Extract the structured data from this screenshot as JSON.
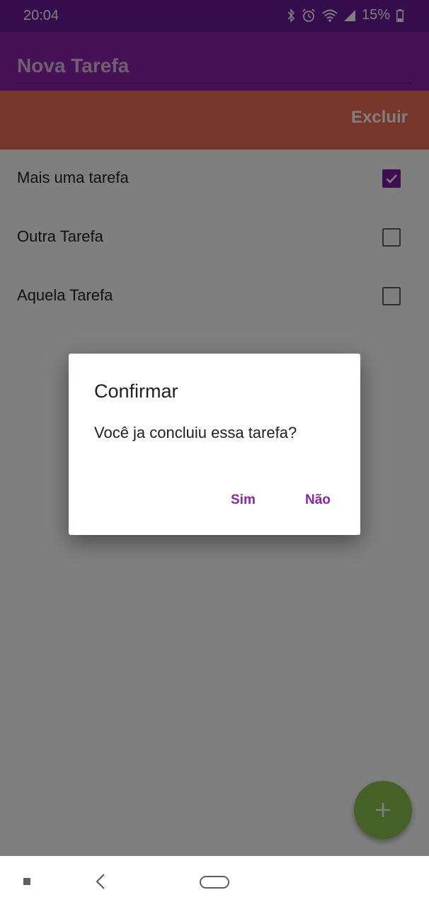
{
  "status_bar": {
    "time": "20:04",
    "battery": "15%",
    "icons": [
      "bluetooth-icon",
      "alarm-icon",
      "wifi-icon",
      "signal-icon",
      "battery-icon"
    ]
  },
  "app_bar": {
    "input_value": "Nova Tarefa",
    "color": "#8e24aa"
  },
  "swipe_action": {
    "label": "Excluir",
    "color": "#ef6c52"
  },
  "tasks": [
    {
      "label": "Mais uma tarefa",
      "checked": true
    },
    {
      "label": "Outra Tarefa",
      "checked": false
    },
    {
      "label": "Aquela Tarefa",
      "checked": false
    }
  ],
  "fab": {
    "icon": "add-icon",
    "color": "#8bc34a"
  },
  "dialog": {
    "title": "Confirmar",
    "message": "Você ja concluiu essa tarefa?",
    "yes_label": "Sim",
    "no_label": "Não",
    "accent": "#8e24aa"
  },
  "nav_bar": {
    "icons": [
      "recent-apps-icon",
      "back-icon",
      "home-icon"
    ]
  }
}
